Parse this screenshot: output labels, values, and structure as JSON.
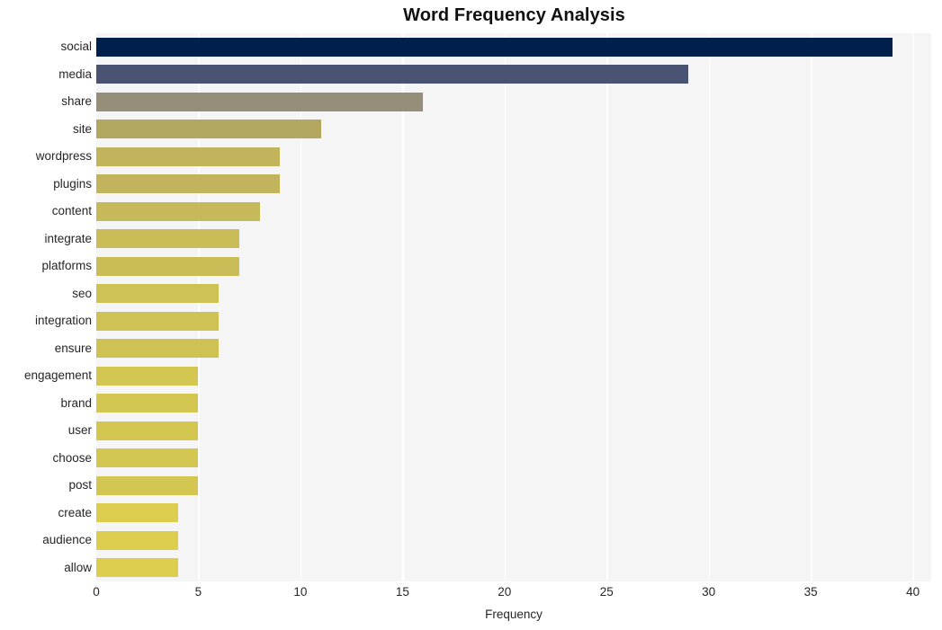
{
  "chart_data": {
    "type": "bar",
    "orientation": "horizontal",
    "title": "Word Frequency Analysis",
    "xlabel": "Frequency",
    "ylabel": "",
    "categories": [
      "social",
      "media",
      "share",
      "site",
      "wordpress",
      "plugins",
      "content",
      "integrate",
      "platforms",
      "seo",
      "integration",
      "ensure",
      "engagement",
      "brand",
      "user",
      "choose",
      "post",
      "create",
      "audience",
      "allow"
    ],
    "values": [
      39,
      29,
      16,
      11,
      9,
      9,
      8,
      7,
      7,
      6,
      6,
      6,
      5,
      5,
      5,
      5,
      5,
      4,
      4,
      4
    ],
    "bar_colors": [
      "#00204c",
      "#4a5472",
      "#958e78",
      "#b4a860",
      "#c2b45c",
      "#c2b45c",
      "#c6b95a",
      "#cabd57",
      "#cabd57",
      "#cfc254",
      "#cfc254",
      "#cfc254",
      "#d4c751",
      "#d4c751",
      "#d4c751",
      "#d4c751",
      "#d4c751",
      "#dccd4e",
      "#dccd4e",
      "#dccd4e"
    ],
    "xlim": [
      0,
      40.9
    ],
    "xticks": [
      0,
      5,
      10,
      15,
      20,
      25,
      30,
      35,
      40
    ],
    "xtick_labels": [
      "0",
      "5",
      "10",
      "15",
      "20",
      "25",
      "30",
      "35",
      "40"
    ],
    "grid": {
      "vertical": true,
      "horizontal": false,
      "color": "#ffffff"
    },
    "legend": null,
    "plot_background": "#f5f5f6",
    "figure_background": "#ffffff"
  }
}
